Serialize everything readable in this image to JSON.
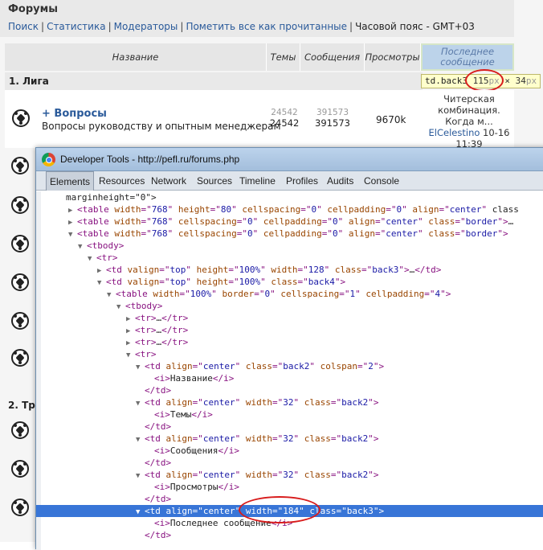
{
  "forum": {
    "title": "Форумы",
    "nav": [
      "Поиск",
      "Статистика",
      "Модераторы",
      "Пометить все как прочитанные"
    ],
    "timezone": "Часовой пояс - GMT+03",
    "headers": {
      "name": "Название",
      "topics": "Темы",
      "messages": "Сообщения",
      "views": "Просмотры",
      "last_line1": "Последнее",
      "last_line2": "сообщение"
    },
    "category1": "1. Лига",
    "category2": "2. Тр",
    "row": {
      "name": "+ Вопросы",
      "desc": "Вопросы руководству и опытным менеджерам",
      "topics_faint": "24542",
      "topics": "24542",
      "messages_faint": "391573",
      "messages": "391573",
      "views": "9670k",
      "last_line1": "Читерская",
      "last_line2": "комбинация.",
      "last_line3": "Когда м...",
      "last_user": "ElCelestino",
      "last_date": "10-16",
      "last_time": "11:39"
    },
    "tooltip": {
      "selector": "td.back3",
      "width": "115",
      "unit1": "px",
      "times": " × ",
      "height": "34",
      "unit2": "px"
    }
  },
  "devtools": {
    "title": "Developer Tools - http://pefl.ru/forums.php",
    "tabs": [
      "Elements",
      "Resources",
      "Network",
      "Sources",
      "Timeline",
      "Profiles",
      "Audits",
      "Console"
    ],
    "lines": [
      "marginheight=\"0\">",
      "<table width=\"768\" height=\"80\" cellspacing=\"0\" cellpadding=\"0\" align=\"center\" class",
      "<table width=\"768\" cellspacing=\"0\" cellpadding=\"0\" align=\"center\" class=\"border\">…<",
      "<table width=\"768\" cellspacing=\"0\" cellpadding=\"0\" align=\"center\" class=\"border\">",
      "<tbody>",
      "<tr>",
      "<td valign=\"top\" height=\"100%\" width=\"128\" class=\"back3\">…</td>",
      "<td valign=\"top\" height=\"100%\" class=\"back4\">",
      "<table width=\"100%\" border=\"0\" cellspacing=\"1\" cellpadding=\"4\">",
      "<tbody>",
      "<tr>…</tr>",
      "<tr>…</tr>",
      "<tr>…</tr>",
      "<tr>",
      "<td align=\"center\" class=\"back2\" colspan=\"2\">",
      "<i>Название</i>",
      "</td>",
      "<td align=\"center\" width=\"32\" class=\"back2\">",
      "<i>Темы</i>",
      "</td>",
      "<td align=\"center\" width=\"32\" class=\"back2\">",
      "<i>Сообщения</i>",
      "</td>",
      "<td align=\"center\" width=\"32\" class=\"back2\">",
      "<i>Просмотры</i>",
      "</td>",
      "<td align=\"center\" width=\"184\" class=\"back3\">",
      "<i>Последнее сообщение</i>",
      "</td>"
    ]
  }
}
